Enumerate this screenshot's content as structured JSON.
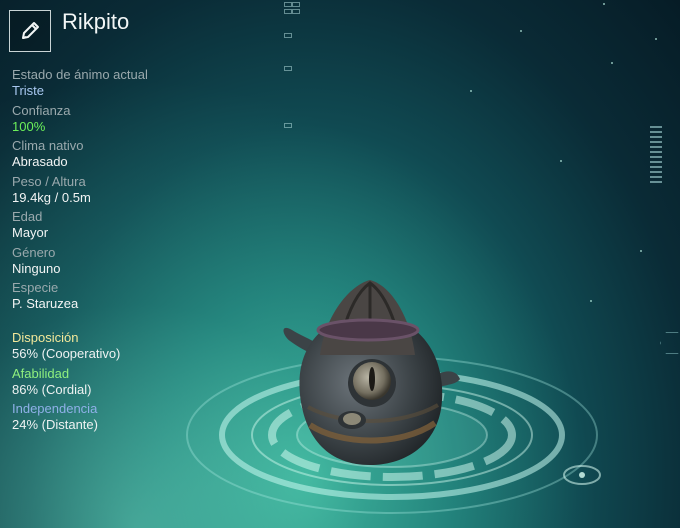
{
  "creature": {
    "name": "Rikpito",
    "edit_icon": "pencil-icon"
  },
  "stats": [
    {
      "label": "Estado de ánimo actual",
      "value": "Triste"
    },
    {
      "label": "Confianza",
      "value": "100%"
    },
    {
      "label": "Clima nativo",
      "value": "Abrasado"
    },
    {
      "label": "Peso / Altura",
      "value": "19.4kg / 0.5m"
    },
    {
      "label": "Edad",
      "value": "Mayor"
    },
    {
      "label": "Género",
      "value": "Ninguno"
    },
    {
      "label": "Especie",
      "value": "P. Staruzea"
    }
  ],
  "traits": [
    {
      "label": "Disposición",
      "value": "56% (Cooperativo)"
    },
    {
      "label": "Afabilidad",
      "value": "86% (Cordial)"
    },
    {
      "label": "Independencia",
      "value": "24% (Distante)"
    }
  ],
  "colors": {
    "mood": "#a8c8f0",
    "trust": "#6cf05a",
    "disposition": "#f3e89a",
    "friendliness": "#8ff07e",
    "independence": "#8fb0e8"
  }
}
